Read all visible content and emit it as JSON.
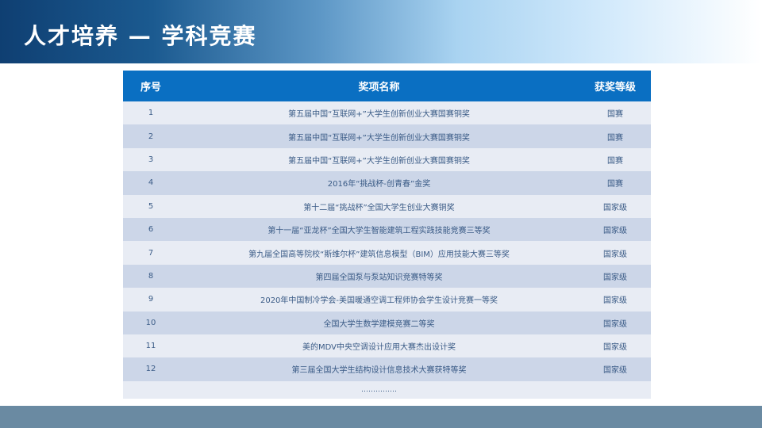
{
  "header": {
    "title": "人才培养 — 学科竞赛"
  },
  "table": {
    "columns": [
      "序号",
      "奖项名称",
      "获奖等级"
    ],
    "rows": [
      {
        "no": "1",
        "name": "第五届中国“互联网+”大学生创新创业大赛国赛铜奖",
        "level": "国赛"
      },
      {
        "no": "2",
        "name": "第五届中国“互联网+”大学生创新创业大赛国赛铜奖",
        "level": "国赛"
      },
      {
        "no": "3",
        "name": "第五届中国“互联网+”大学生创新创业大赛国赛铜奖",
        "level": "国赛"
      },
      {
        "no": "4",
        "name": "2016年“挑战杯-创青春”金奖",
        "level": "国赛"
      },
      {
        "no": "5",
        "name": "第十二届“挑战杯”全国大学生创业大赛铜奖",
        "level": "国家级"
      },
      {
        "no": "6",
        "name": "第十一届“亚龙杯”全国大学生智能建筑工程实践技能竞赛三等奖",
        "level": "国家级"
      },
      {
        "no": "7",
        "name": "第九届全国高等院校“斯维尔杯”建筑信息模型（BIM）应用技能大赛三等奖",
        "level": "国家级"
      },
      {
        "no": "8",
        "name": "第四届全国泵与泵站知识竞赛特等奖",
        "level": "国家级"
      },
      {
        "no": "9",
        "name": "2020年中国制冷学会-美国暖通空调工程师协会学生设计竞赛一等奖",
        "level": "国家级"
      },
      {
        "no": "10",
        "name": "全国大学生数学建模竞赛二等奖",
        "level": "国家级"
      },
      {
        "no": "11",
        "name": "美的MDV中央空调设计应用大赛杰出设计奖",
        "level": "国家级"
      },
      {
        "no": "12",
        "name": "第三届全国大学生结构设计信息技术大赛获特等奖",
        "level": "国家级"
      }
    ],
    "ellipsis": "……………"
  },
  "colors": {
    "header_dark": "#0f3f72",
    "table_header": "#0a6fc2",
    "row_light": "#e8ecf4",
    "row_dark": "#ccd6e8",
    "footer": "#6a8aa2"
  }
}
